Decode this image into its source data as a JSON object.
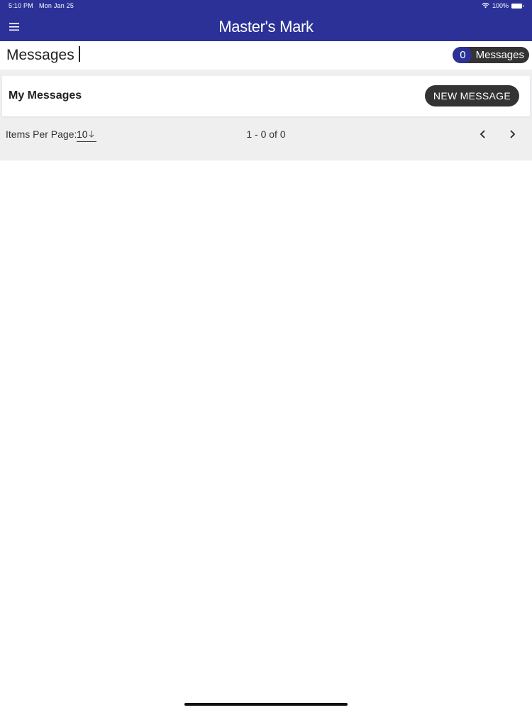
{
  "status_bar": {
    "time": "5:10 PM",
    "date": "Mon Jan 25",
    "battery": "100%",
    "icons": [
      "wifi-icon",
      "battery-icon"
    ]
  },
  "header": {
    "app_title": "Master's Mark",
    "menu_icon": "hamburger-menu-icon"
  },
  "page": {
    "title": "Messages",
    "message_count": "0",
    "message_label": "Messages"
  },
  "card": {
    "title": "My Messages",
    "new_message_label": "NEW MESSAGE"
  },
  "pagination": {
    "items_per_page_label": "Items Per Page:",
    "items_per_page_value": "10",
    "range_label": "1 - 0 of 0",
    "icons": [
      "chevron-left-icon",
      "chevron-right-icon",
      "arrow-down-icon"
    ]
  },
  "colors": {
    "brand": "#2b3197",
    "button_dark": "#333333",
    "content_bg": "#efeff0"
  }
}
